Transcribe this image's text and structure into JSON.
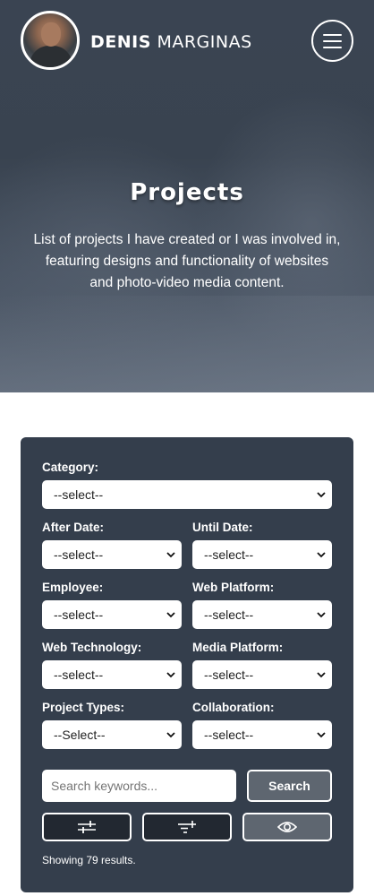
{
  "header": {
    "brand_first": "DENIS",
    "brand_last": "MARGINAS",
    "menu_icon": "hamburger-icon",
    "avatar_icon": "avatar"
  },
  "hero": {
    "title": "Projects",
    "description": "List of projects I have created or I was involved in, featuring designs and functionality of websites and photo-video media content."
  },
  "filters": {
    "category": {
      "label": "Category:",
      "value": "--select--"
    },
    "after_date": {
      "label": "After Date:",
      "value": "--select--"
    },
    "until_date": {
      "label": "Until Date:",
      "value": "--select--"
    },
    "employee": {
      "label": "Employee:",
      "value": "--select--"
    },
    "web_platform": {
      "label": "Web Platform:",
      "value": "--select--"
    },
    "web_technology": {
      "label": "Web Technology:",
      "value": "--select--"
    },
    "media_platform": {
      "label": "Media Platform:",
      "value": "--select--"
    },
    "project_types": {
      "label": "Project Types:",
      "value": "--Select--"
    },
    "collaboration": {
      "label": "Collaboration:",
      "value": "--select--"
    }
  },
  "search": {
    "placeholder": "Search keywords...",
    "button_label": "Search"
  },
  "actions": {
    "filters_icon": "sliders-icon",
    "sort_icon": "sort-add-icon",
    "view_icon": "eye-icon"
  },
  "results_text": "Showing 79 results.",
  "colors": {
    "panel": "#343e4c",
    "hero": "#3a4452",
    "button_dark": "#222831",
    "button_grey": "#5e6670"
  }
}
